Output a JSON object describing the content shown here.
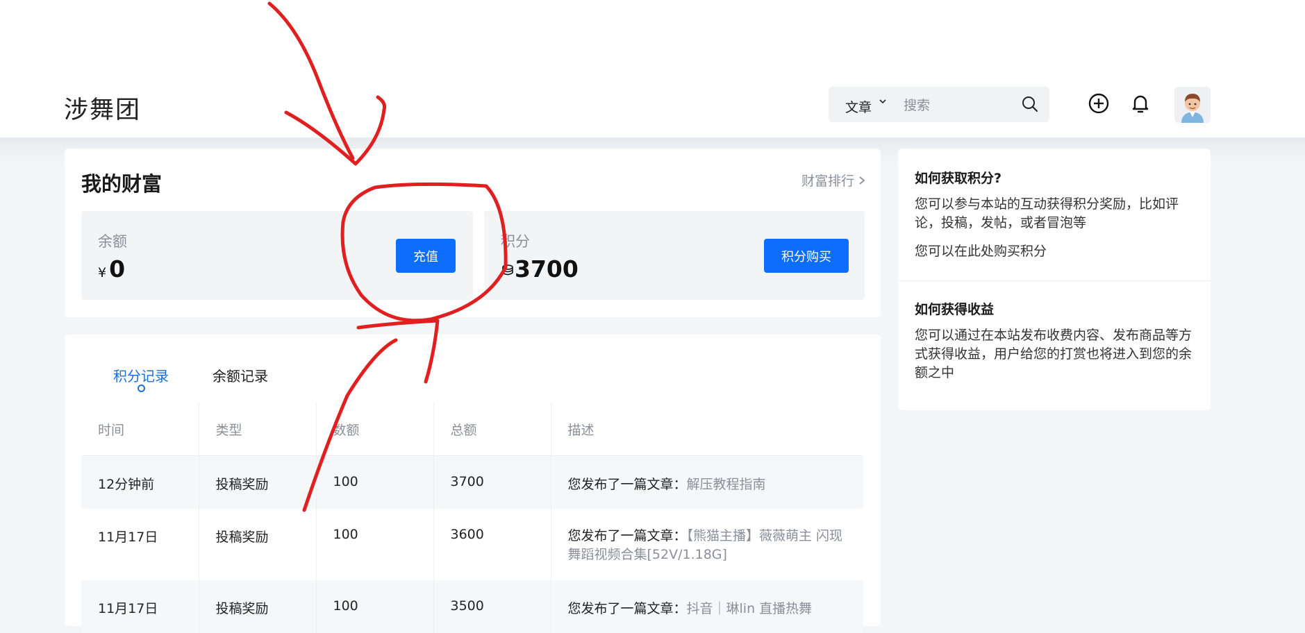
{
  "header": {
    "logo": "涉舞团",
    "search_category": "文章",
    "search_placeholder": "搜索"
  },
  "wealth": {
    "title": "我的财富",
    "rank_link": "财富排行",
    "balance_label": "余额",
    "balance_currency": "¥",
    "balance_value": "0",
    "recharge_button": "充值",
    "points_label": "积分",
    "points_value": "3700",
    "buy_points_button": "积分购买"
  },
  "tabs": [
    "积分记录",
    "余额记录"
  ],
  "table": {
    "headers": [
      "时间",
      "类型",
      "数额",
      "总额",
      "描述"
    ],
    "rows": [
      {
        "time": "12分钟前",
        "type": "投稿奖励",
        "amount": "100",
        "total": "3700",
        "desc_prefix": "您发布了一篇文章：",
        "desc_link": "解压教程指南"
      },
      {
        "time": "11月17日",
        "type": "投稿奖励",
        "amount": "100",
        "total": "3600",
        "desc_prefix": "您发布了一篇文章：",
        "desc_link": "【熊猫主播】薇薇萌主 闪现舞蹈视频合集[52V/1.18G]"
      },
      {
        "time": "11月17日",
        "type": "投稿奖励",
        "amount": "100",
        "total": "3500",
        "desc_prefix": "您发布了一篇文章：",
        "desc_link": "抖音｜琳lin 直播热舞"
      }
    ]
  },
  "sidebar": {
    "section1_title": "如何获取积分?",
    "section1_text1": "您可以参与本站的互动获得积分奖励，比如评论，投稿，发帖，或者冒泡等",
    "section1_text2": "您可以在此处购买积分",
    "section2_title": "如何获得收益",
    "section2_text": "您可以通过在本站发布收费内容、发布商品等方式获得收益，用户给您的打赏也将进入到您的余额之中"
  },
  "colors": {
    "accent": "#0d6efd",
    "tab_active": "#1a6fd8",
    "amount_green": "#1a8a1a",
    "annotation_red": "#e02020"
  }
}
